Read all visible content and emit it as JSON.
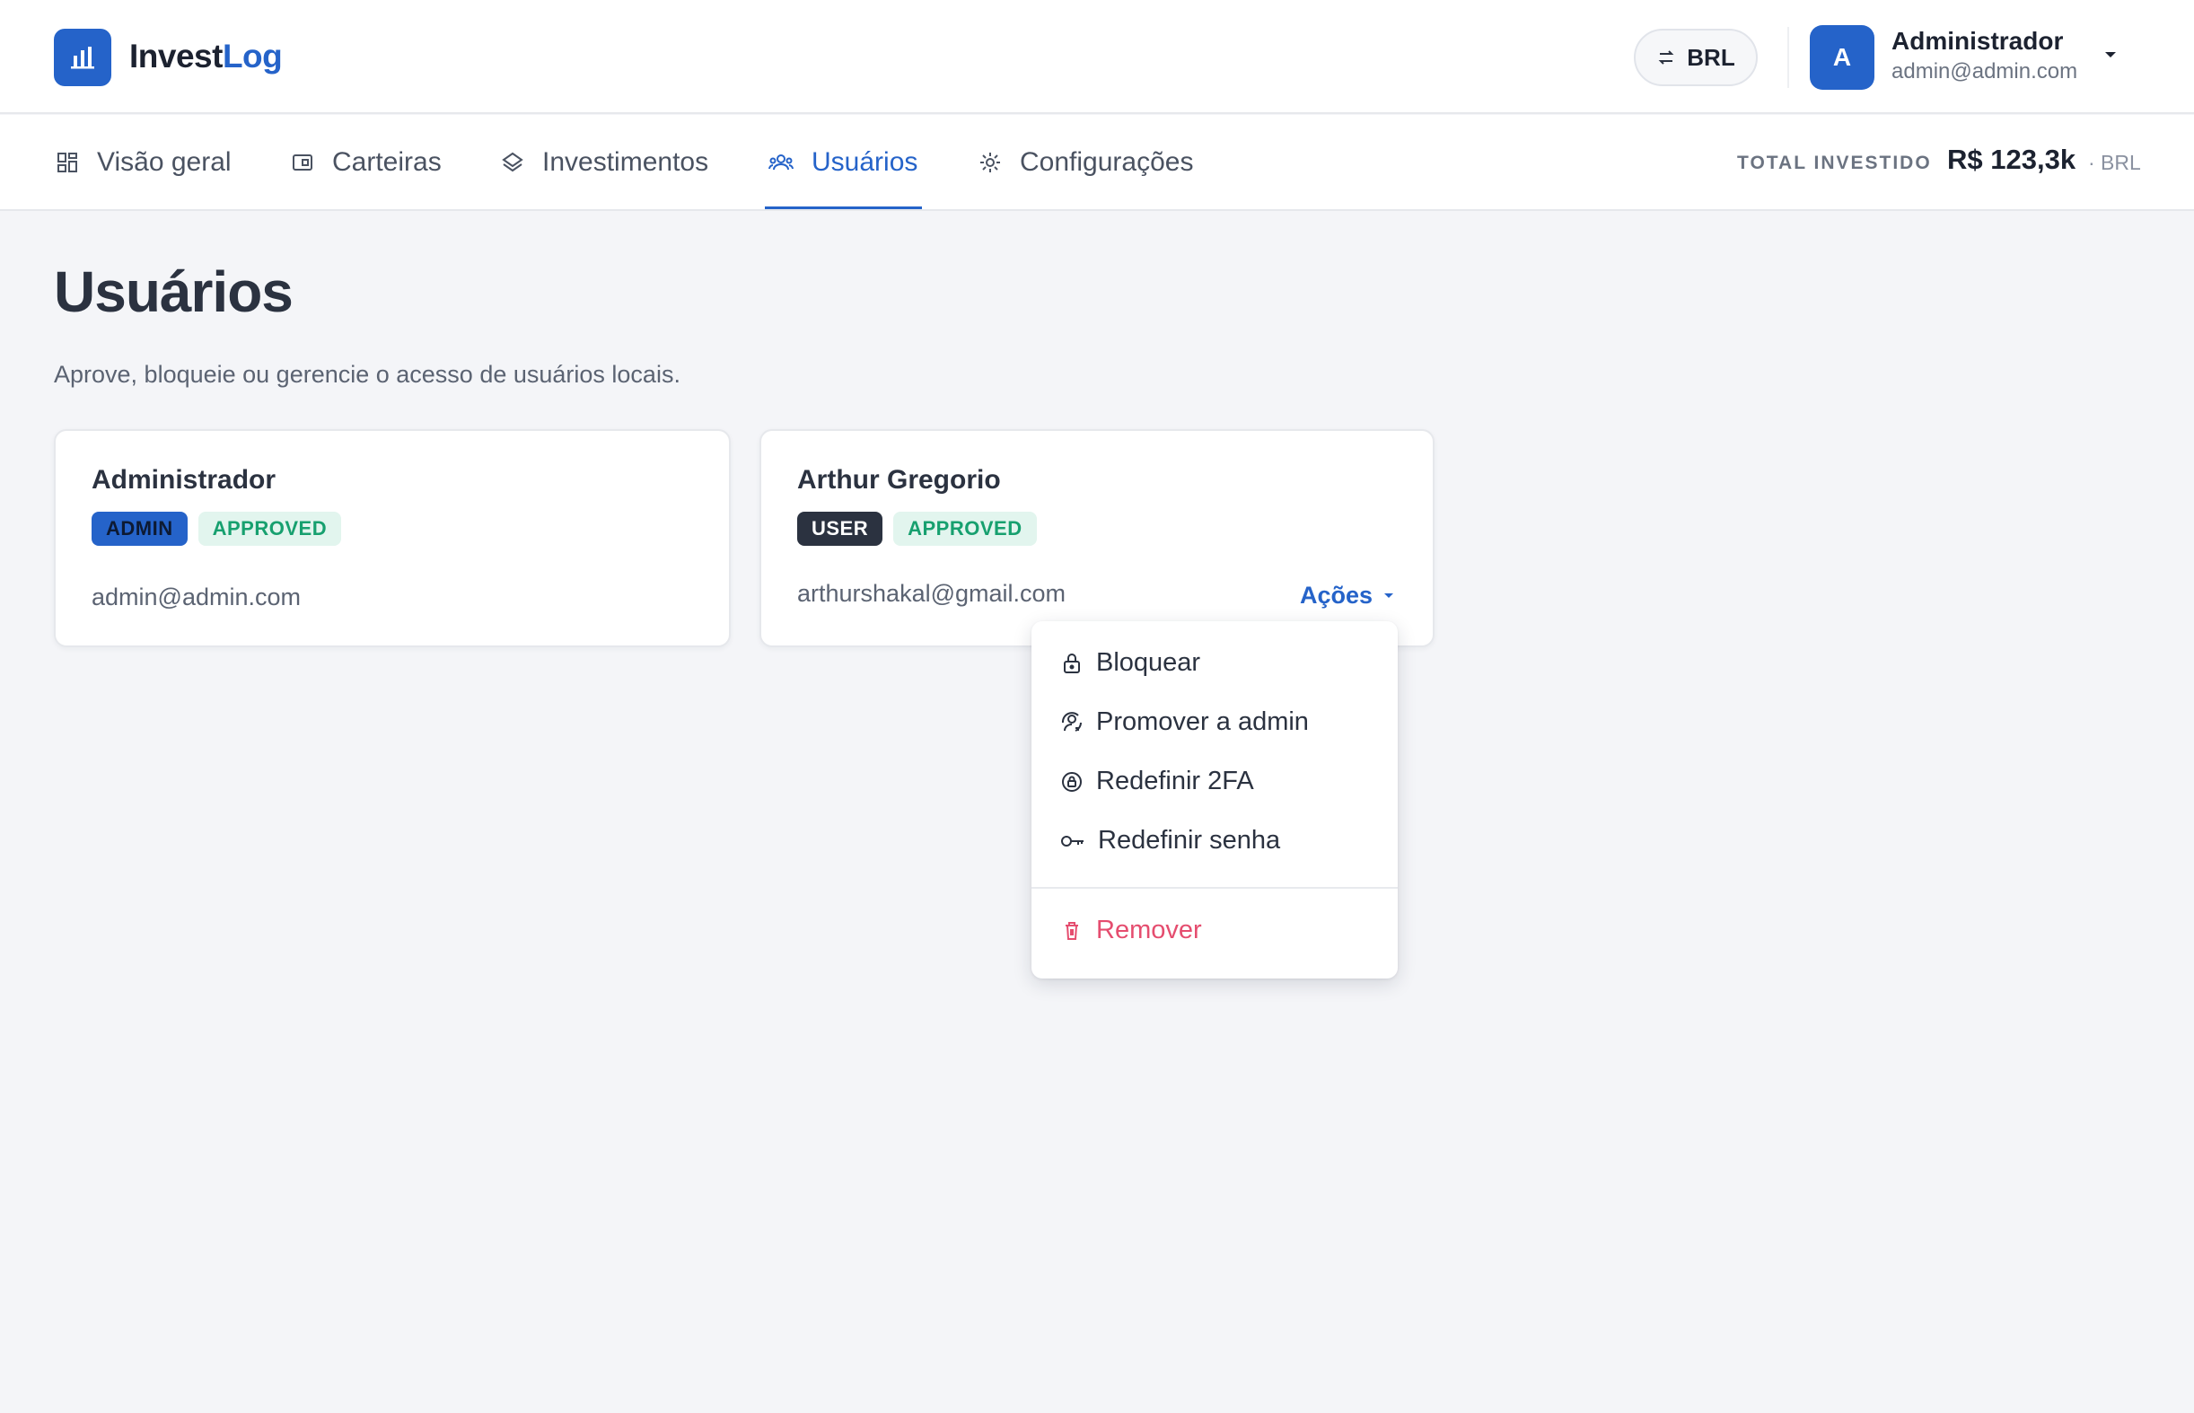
{
  "app": {
    "brand_part1": "Invest",
    "brand_part2": "Log",
    "brand_color": "#2563c9"
  },
  "header": {
    "currency_label": "BRL",
    "user": {
      "initial": "A",
      "name": "Administrador",
      "email": "admin@admin.com"
    }
  },
  "nav": {
    "tabs": [
      {
        "label": "Visão geral",
        "icon": "dashboard-icon"
      },
      {
        "label": "Carteiras",
        "icon": "wallet-icon"
      },
      {
        "label": "Investimentos",
        "icon": "layers-icon"
      },
      {
        "label": "Usuários",
        "icon": "users-icon",
        "active": true
      },
      {
        "label": "Configurações",
        "icon": "gear-icon"
      }
    ],
    "total_label": "TOTAL INVESTIDO",
    "total_value": "R$ 123,3k",
    "total_currency": "· BRL"
  },
  "page": {
    "title": "Usuários",
    "subtitle": "Aprove, bloqueie ou gerencie o acesso de usuários locais."
  },
  "users": [
    {
      "name": "Administrador",
      "role": "ADMIN",
      "status": "APPROVED",
      "email": "admin@admin.com"
    },
    {
      "name": "Arthur Gregorio",
      "role": "USER",
      "status": "APPROVED",
      "email": "arthurshakal@gmail.com",
      "actions_label": "Ações"
    }
  ],
  "actions_menu": {
    "items": [
      {
        "label": "Bloquear",
        "icon": "lock-icon"
      },
      {
        "label": "Promover a admin",
        "icon": "promote-icon"
      },
      {
        "label": "Redefinir 2FA",
        "icon": "reset-2fa-icon"
      },
      {
        "label": "Redefinir senha",
        "icon": "key-icon"
      }
    ],
    "danger_item": {
      "label": "Remover",
      "icon": "trash-icon",
      "color": "#e54d6f"
    }
  }
}
